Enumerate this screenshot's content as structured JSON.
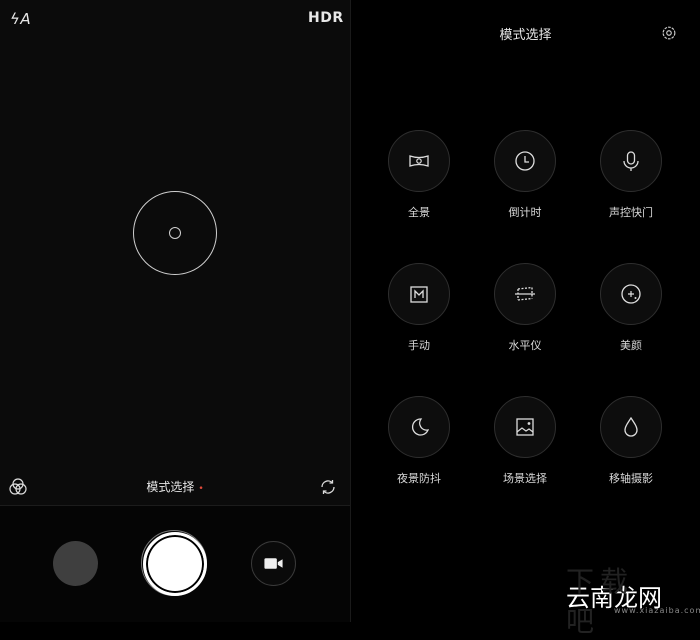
{
  "camera": {
    "flash_label": "ϟA",
    "hdr_label": "HDR",
    "mode_label": "模式选择",
    "mode_indicator": "•"
  },
  "mode_panel": {
    "title": "模式选择",
    "modes": [
      {
        "label": "全景",
        "icon": "panorama-icon"
      },
      {
        "label": "倒计时",
        "icon": "timer-icon"
      },
      {
        "label": "声控快门",
        "icon": "microphone-icon"
      },
      {
        "label": "手动",
        "icon": "manual-icon"
      },
      {
        "label": "水平仪",
        "icon": "level-icon"
      },
      {
        "label": "美颜",
        "icon": "beauty-icon"
      },
      {
        "label": "夜景防抖",
        "icon": "night-moon-icon"
      },
      {
        "label": "场景选择",
        "icon": "scene-icon"
      },
      {
        "label": "移轴摄影",
        "icon": "tilt-shift-icon"
      }
    ]
  },
  "watermark": {
    "text": "云南龙网",
    "bg_text": "下载吧",
    "sub": "www.xiazaiba.com"
  },
  "colors": {
    "accent_dot": "#e04a3a",
    "background": "#000000"
  }
}
